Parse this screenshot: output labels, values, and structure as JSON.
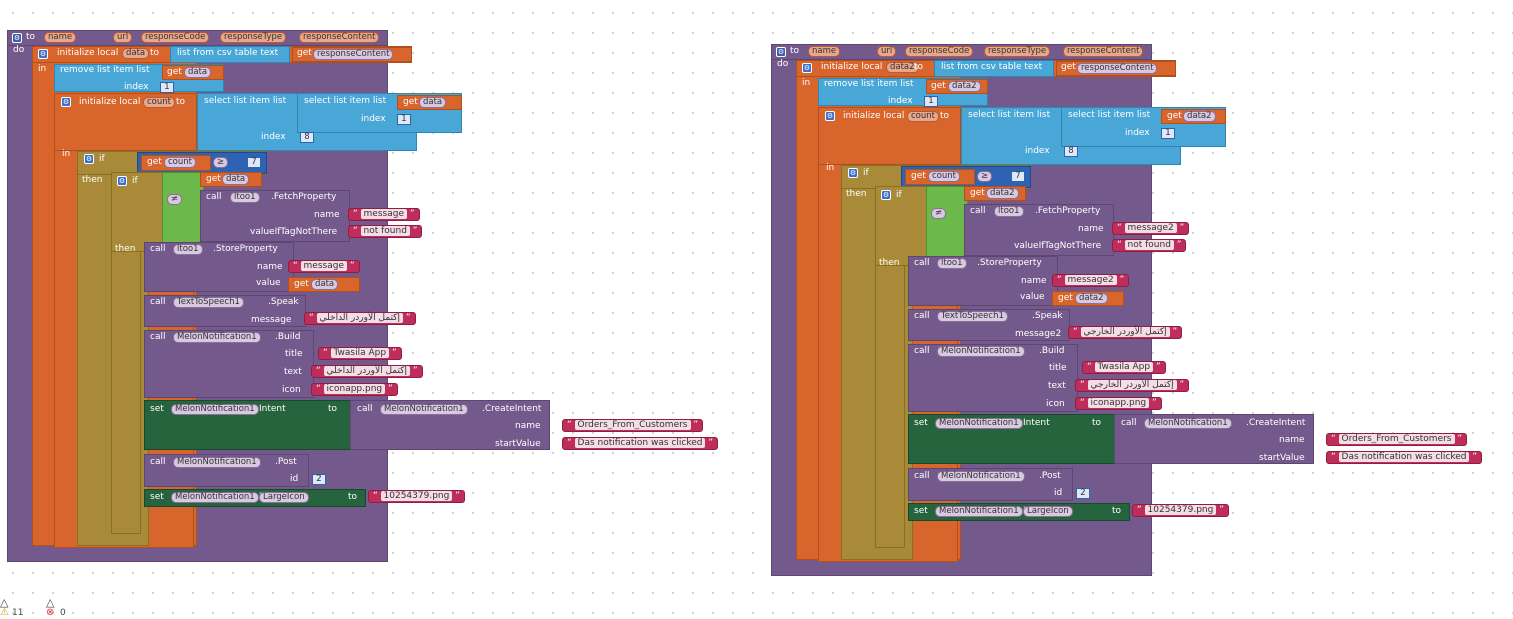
{
  "left": {
    "keyword_to": "to",
    "name": "name",
    "params": [
      "url",
      "responseCode",
      "responseType",
      "responseContent"
    ],
    "do": "do",
    "in": "in",
    "init_data": "initialize local",
    "var_data": "data",
    "to": "to",
    "list_from_csv": "list from csv table  text",
    "get": "get",
    "response_content": "responseContent",
    "remove_list_item": "remove list item  list",
    "get_data": "data",
    "index": "index",
    "num_1": "1",
    "init_count": "initialize local",
    "var_count": "count",
    "select_list_item": "select list item  list",
    "num_8": "8",
    "if": "if",
    "count": "count",
    "ge": "≥",
    "num_7": "7",
    "then": "then",
    "ne": "≠",
    "call": "call",
    "itoo": "ltoo1",
    "fetch": ".FetchProperty",
    "message": "message",
    "value_if": "valueIfTagNotThere",
    "not_found": "not found",
    "store": ".StoreProperty",
    "value": "value",
    "tts": "TextToSpeech1",
    "speak": ".Speak",
    "speak_msg": "إكتمل الأوردر الداخلي",
    "melon": "MelonNotification1",
    "build": ".Build",
    "title": "title",
    "app_title": "Twasila App",
    "text": "text",
    "icon": "icon",
    "icon_val": "iconapp.png",
    "set": "set",
    "intent": "Intent",
    "create_intent": ".CreateIntent",
    "intent_name": "Orders_From_Customers",
    "start_value": "startValue",
    "start_val": "Das notification was clicked",
    "post": ".Post",
    "id": "id",
    "num_2": "2",
    "large_icon": "LargeIcon",
    "large_icon_val": "10254379.png"
  },
  "right": {
    "keyword_to": "to",
    "name": "name",
    "params": [
      "url",
      "responseCode",
      "responseType",
      "responseContent"
    ],
    "do": "do",
    "in": "in",
    "init_data": "initialize local",
    "var_data": "data2",
    "to": "to",
    "list_from_csv": "list from csv table  text",
    "get": "get",
    "response_content": "responseContent",
    "remove_list_item": "remove list item  list",
    "get_data": "data2",
    "index": "index",
    "num_1": "1",
    "init_count": "initialize local",
    "var_count": "count",
    "select_list_item": "select list item  list",
    "num_8": "8",
    "if": "if",
    "count": "count",
    "ge": "≥",
    "num_7": "7",
    "then": "then",
    "ne": "≠",
    "call": "call",
    "itoo": "ltoo1",
    "fetch": ".FetchProperty",
    "message": "message2",
    "value_if": "valueIfTagNotThere",
    "not_found": "not found",
    "store": ".StoreProperty",
    "value": "value",
    "tts": "TextToSpeech1",
    "speak": ".Speak",
    "speak_msg": "إكتمل الأوردر الخارجي",
    "melon": "MelonNotification1",
    "build": ".Build",
    "title": "title",
    "app_title": "Twasila App",
    "text": "text",
    "icon": "icon",
    "icon_val": "iconapp.png",
    "set": "set",
    "intent": "Intent",
    "create_intent": ".CreateIntent",
    "intent_name": "Orders_From_Customers",
    "start_value": "startValue",
    "start_val": "Das notification was clicked",
    "post": ".Post",
    "id": "id",
    "num_2": "2",
    "large_icon": "LargeIcon",
    "large_icon_val": "10254379.png"
  },
  "status": {
    "warnings": "11",
    "errors": "0"
  }
}
